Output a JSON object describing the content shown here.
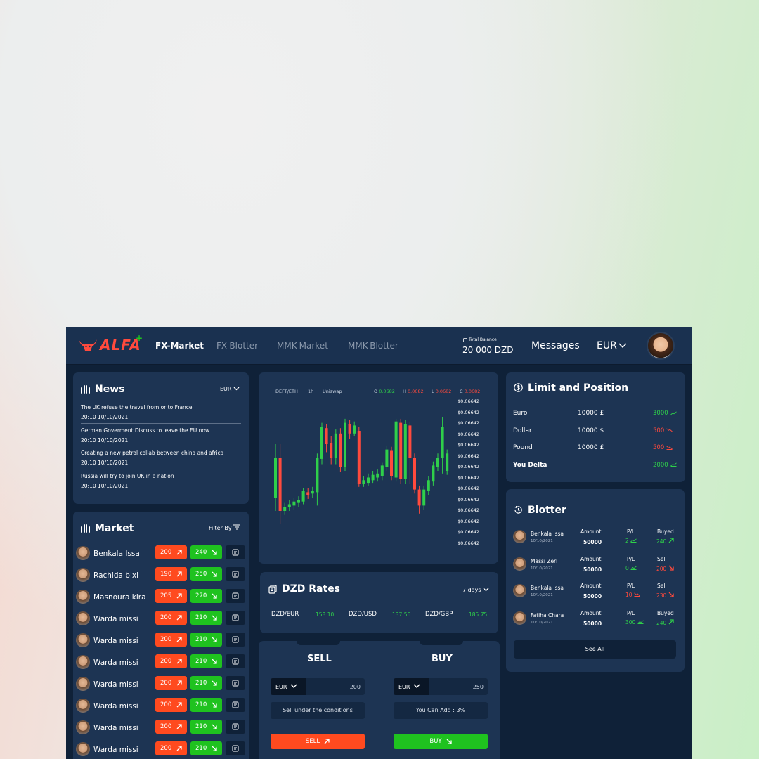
{
  "header": {
    "logo_text": "ALFA",
    "logo_plus": "+",
    "nav": [
      "FX-Market",
      "FX-Blotter",
      "MMK-Market",
      "MMK-Blotter"
    ],
    "balance_label": "Total Balance",
    "balance_value": "20 000 DZD",
    "messages": "Messages",
    "currency": "EUR"
  },
  "news": {
    "title": "News",
    "currency": "EUR",
    "items": [
      {
        "title": "The UK refuse the travel from or to France",
        "time": "20:10 10/10/2021"
      },
      {
        "title": "German Goverment Discuss to leave the EU now",
        "time": "20:10 10/10/2021"
      },
      {
        "title": "Creating a new petrol collab between china and africa",
        "time": "20:10 10/10/2021"
      },
      {
        "title": "Russia will try to join UK in a nation",
        "time": "20:10 10/10/2021"
      }
    ]
  },
  "market": {
    "title": "Market",
    "filter": "Filter By",
    "rows": [
      {
        "name": "Benkala Issa",
        "sell": "200",
        "buy": "240"
      },
      {
        "name": "Rachida bixi",
        "sell": "190",
        "buy": "250"
      },
      {
        "name": "Masnoura kira",
        "sell": "205",
        "buy": "270"
      },
      {
        "name": "Warda missi",
        "sell": "200",
        "buy": "210"
      },
      {
        "name": "Warda missi",
        "sell": "200",
        "buy": "210"
      },
      {
        "name": "Warda missi",
        "sell": "200",
        "buy": "210"
      },
      {
        "name": "Warda missi",
        "sell": "200",
        "buy": "210"
      },
      {
        "name": "Warda missi",
        "sell": "200",
        "buy": "210"
      },
      {
        "name": "Warda missi",
        "sell": "200",
        "buy": "210"
      },
      {
        "name": "Warda missi",
        "sell": "200",
        "buy": "210"
      }
    ]
  },
  "chart_head": {
    "pair": "DEFT/ETH",
    "interval": "1h",
    "exchange": "Uniswap",
    "o_label": "O",
    "o_value": "0.0682",
    "h_label": "H",
    "h_value": "0.0682",
    "l_label": "L",
    "l_value": "0.0682",
    "c_label": "C",
    "c_value": "0.0682"
  },
  "chart_data": {
    "type": "candlestick",
    "title": "",
    "y_ticks": [
      "$0.06642",
      "$0.06642",
      "$0.06642",
      "$0.06642",
      "$0.06642",
      "$0.06642",
      "$0.06642",
      "$0.06642",
      "$0.06642",
      "$0.06642",
      "$0.06642",
      "$0.06642",
      "$0.06642",
      "$0.06642"
    ],
    "candles": [
      {
        "o": 3,
        "c": 6,
        "l": 2,
        "h": 7
      },
      {
        "o": 6,
        "c": 2,
        "l": 1,
        "h": 7
      },
      {
        "o": 2,
        "c": 2.3,
        "l": 1.7,
        "h": 2.6
      },
      {
        "o": 2.3,
        "c": 2.5,
        "l": 2,
        "h": 2.8
      },
      {
        "o": 2.4,
        "c": 2.7,
        "l": 2.1,
        "h": 3.0
      },
      {
        "o": 2.6,
        "c": 2.8,
        "l": 2.3,
        "h": 3.1
      },
      {
        "o": 2.7,
        "c": 3.5,
        "l": 2.5,
        "h": 3.7
      },
      {
        "o": 3.4,
        "c": 3.2,
        "l": 2.9,
        "h": 3.7
      },
      {
        "o": 3.3,
        "c": 3.5,
        "l": 3.0,
        "h": 3.8
      },
      {
        "o": 3.4,
        "c": 6.0,
        "l": 2.4,
        "h": 6.3
      },
      {
        "o": 5.9,
        "c": 8.3,
        "l": 5.5,
        "h": 8.6
      },
      {
        "o": 8.2,
        "c": 7.0,
        "l": 6.4,
        "h": 8.5
      },
      {
        "o": 7.1,
        "c": 6.0,
        "l": 5.5,
        "h": 7.6
      },
      {
        "o": 6.0,
        "c": 7.8,
        "l": 5.5,
        "h": 8.1
      },
      {
        "o": 7.8,
        "c": 5.3,
        "l": 4.9,
        "h": 8.2
      },
      {
        "o": 5.3,
        "c": 8.6,
        "l": 5.0,
        "h": 8.9
      },
      {
        "o": 8.5,
        "c": 7.8,
        "l": 7.4,
        "h": 8.8
      },
      {
        "o": 7.8,
        "c": 8.4,
        "l": 7.6,
        "h": 8.7
      },
      {
        "o": 8.0,
        "c": 4.0,
        "l": 3.8,
        "h": 8.3
      },
      {
        "o": 4.0,
        "c": 4.3,
        "l": 3.8,
        "h": 4.6
      },
      {
        "o": 4.1,
        "c": 4.5,
        "l": 3.9,
        "h": 4.8
      },
      {
        "o": 4.3,
        "c": 4.7,
        "l": 4.1,
        "h": 5.0
      },
      {
        "o": 4.5,
        "c": 4.8,
        "l": 4.2,
        "h": 5.1
      },
      {
        "o": 4.6,
        "c": 5.4,
        "l": 4.3,
        "h": 5.6
      },
      {
        "o": 5.3,
        "c": 6.6,
        "l": 5.0,
        "h": 6.9
      },
      {
        "o": 6.5,
        "c": 4.6,
        "l": 4.3,
        "h": 6.8
      },
      {
        "o": 4.5,
        "c": 8.7,
        "l": 4.2,
        "h": 8.9
      },
      {
        "o": 8.6,
        "c": 4.4,
        "l": 4.0,
        "h": 8.9
      },
      {
        "o": 4.4,
        "c": 8.5,
        "l": 4.0,
        "h": 8.8
      },
      {
        "o": 8.4,
        "c": 6.0,
        "l": 4.0,
        "h": 8.7
      },
      {
        "o": 6.0,
        "c": 3.6,
        "l": 3.3,
        "h": 6.3
      },
      {
        "o": 3.6,
        "c": 2.4,
        "l": 1.8,
        "h": 3.9
      },
      {
        "o": 2.4,
        "c": 3.6,
        "l": 2.1,
        "h": 3.9
      },
      {
        "o": 3.5,
        "c": 4.3,
        "l": 3.2,
        "h": 4.6
      },
      {
        "o": 4.2,
        "c": 5.4,
        "l": 3.9,
        "h": 5.7
      },
      {
        "o": 5.3,
        "c": 6.0,
        "l": 5.0,
        "h": 6.3
      },
      {
        "o": 6.0,
        "c": 8.3,
        "l": 4.8,
        "h": 9.0
      },
      {
        "o": 5.0,
        "c": 6.3,
        "l": 4.7,
        "h": 6.6
      }
    ],
    "colors": {
      "up": "#2fcf4a",
      "down": "#ff4a3d"
    }
  },
  "rates": {
    "title": "DZD Rates",
    "period": "7 days",
    "items": [
      {
        "label": "DZD/EUR",
        "value": "158.10"
      },
      {
        "label": "DZD/USD",
        "value": "137.56"
      },
      {
        "label": "DZD/GBP",
        "value": "185.75"
      }
    ]
  },
  "trade": {
    "sell_title": "SELL",
    "buy_title": "BUY",
    "sell_currency": "EUR",
    "buy_currency": "EUR",
    "sell_amount": "200",
    "buy_amount": "250",
    "sell_note": "Sell under the conditions",
    "buy_note": "You Can Add : 3%",
    "sell_button": "SELL",
    "buy_button": "BUY"
  },
  "limits": {
    "title": "Limit and Position",
    "rows": [
      {
        "label": "Euro",
        "value": "10000 £",
        "pl": "3000",
        "trend": "up"
      },
      {
        "label": "Dollar",
        "value": "10000 $",
        "pl": "500",
        "trend": "down"
      },
      {
        "label": "Pound",
        "value": "10000 £",
        "pl": "500",
        "trend": "down"
      },
      {
        "label": "You Delta",
        "value": "",
        "pl": "2000",
        "trend": "up"
      }
    ]
  },
  "blotter": {
    "title": "Blotter",
    "amount_label": "Amount",
    "pl_label": "P/L",
    "rows": [
      {
        "name": "Benkala Issa",
        "date": "10/10/2021",
        "amount": "50000",
        "pl": "2",
        "pl_trend": "up",
        "side": "Buyed",
        "side_value": "240",
        "side_trend": "up"
      },
      {
        "name": "Massi Zeri",
        "date": "10/10/2021",
        "amount": "50000",
        "pl": "0",
        "pl_trend": "up",
        "side": "Sell",
        "side_value": "200",
        "side_trend": "down"
      },
      {
        "name": "Benkala Issa",
        "date": "10/10/2021",
        "amount": "50000",
        "pl": "10",
        "pl_trend": "down",
        "side": "Sell",
        "side_value": "230",
        "side_trend": "down"
      },
      {
        "name": "Fatiha Chara",
        "date": "10/10/2021",
        "amount": "50000",
        "pl": "300",
        "pl_trend": "up",
        "side": "Buyed",
        "side_value": "240",
        "side_trend": "up"
      }
    ],
    "see_all": "See All"
  },
  "colors": {
    "green": "#1fc21f",
    "red": "#ff4a1f",
    "bg": "#0f2138",
    "card": "#1d3453"
  }
}
